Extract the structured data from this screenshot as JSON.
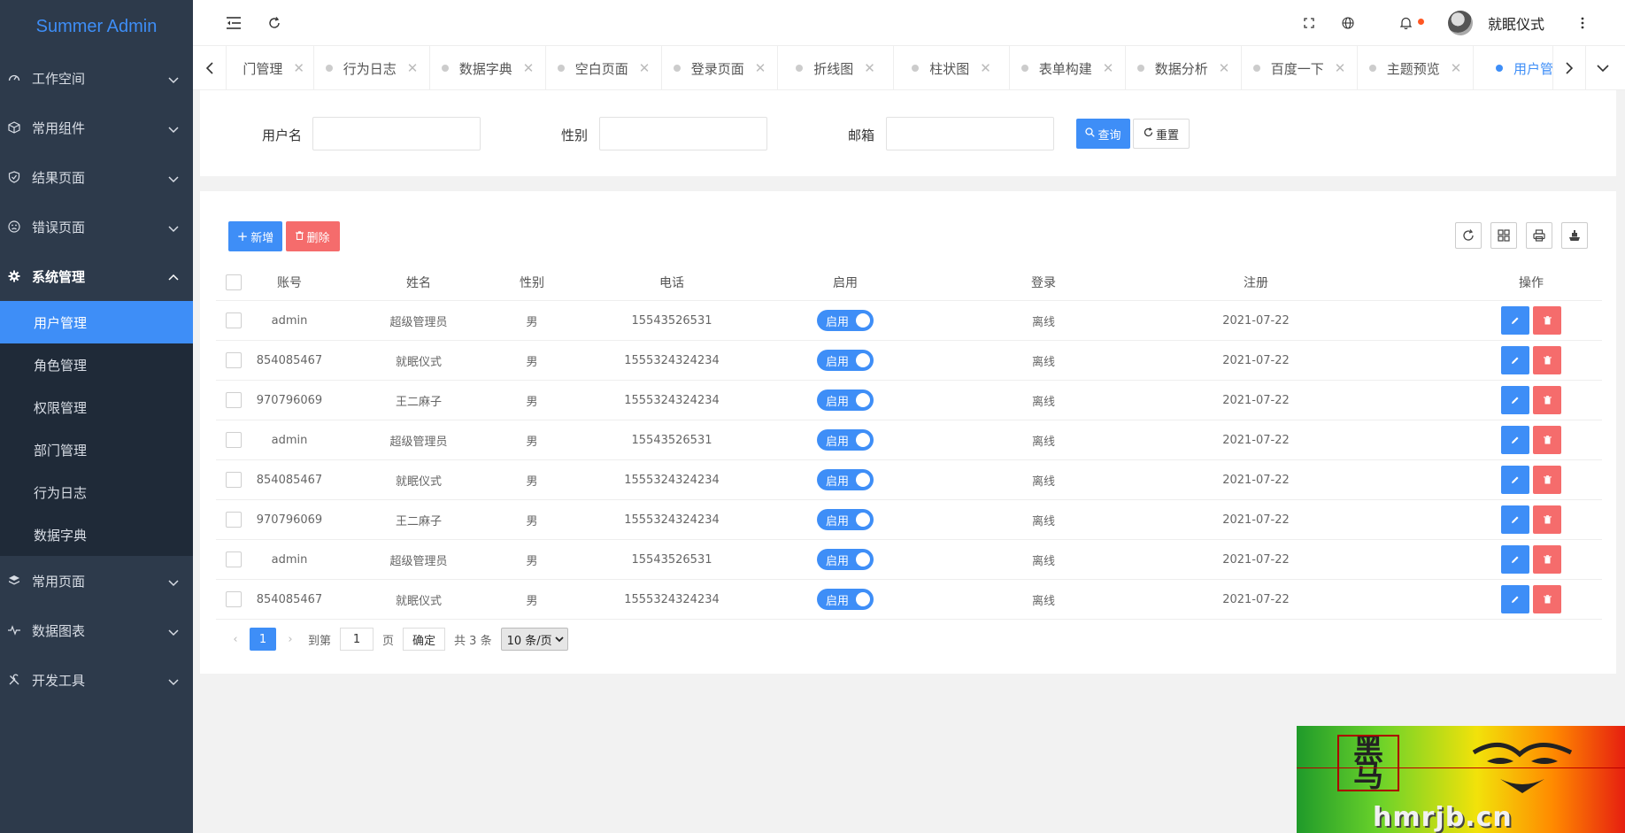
{
  "app": {
    "title": "Summer Admin"
  },
  "sidebar": {
    "menus": [
      {
        "label": "工作空间",
        "icon": "dashboard-icon"
      },
      {
        "label": "常用组件",
        "icon": "cube-icon"
      },
      {
        "label": "结果页面",
        "icon": "shield-check-icon"
      },
      {
        "label": "错误页面",
        "icon": "sad-face-icon"
      },
      {
        "label": "系统管理",
        "icon": "gear-icon"
      }
    ],
    "submenu": [
      "用户管理",
      "角色管理",
      "权限管理",
      "部门管理",
      "行为日志",
      "数据字典"
    ],
    "menus_after": [
      {
        "label": "常用页面",
        "icon": "layers-icon"
      },
      {
        "label": "数据图表",
        "icon": "pulse-icon"
      },
      {
        "label": "开发工具",
        "icon": "tools-icon"
      }
    ]
  },
  "header": {
    "user_name": "就眠仪式"
  },
  "tabs": [
    "门管理",
    "行为日志",
    "数据字典",
    "空白页面",
    "登录页面",
    "折线图",
    "柱状图",
    "表单构建",
    "数据分析",
    "百度一下",
    "主题预览",
    "用户管理"
  ],
  "search": {
    "username_label": "用户名",
    "gender_label": "性别",
    "email_label": "邮箱",
    "query_label": "查询",
    "reset_label": "重置"
  },
  "toolbar": {
    "add_label": "新增",
    "delete_label": "删除"
  },
  "table": {
    "headers": [
      "账号",
      "姓名",
      "性别",
      "电话",
      "启用",
      "登录",
      "注册",
      "操作"
    ],
    "rows": [
      {
        "account": "admin",
        "name": "超级管理员",
        "gender": "男",
        "phone": "15543526531",
        "enabled": "启用",
        "login": "离线",
        "registered": "2021-07-22"
      },
      {
        "account": "854085467",
        "name": "就眠仪式",
        "gender": "男",
        "phone": "1555324324234",
        "enabled": "启用",
        "login": "离线",
        "registered": "2021-07-22"
      },
      {
        "account": "970796069",
        "name": "王二麻子",
        "gender": "男",
        "phone": "1555324324234",
        "enabled": "启用",
        "login": "离线",
        "registered": "2021-07-22"
      },
      {
        "account": "admin",
        "name": "超级管理员",
        "gender": "男",
        "phone": "15543526531",
        "enabled": "启用",
        "login": "离线",
        "registered": "2021-07-22"
      },
      {
        "account": "854085467",
        "name": "就眠仪式",
        "gender": "男",
        "phone": "1555324324234",
        "enabled": "启用",
        "login": "离线",
        "registered": "2021-07-22"
      },
      {
        "account": "970796069",
        "name": "王二麻子",
        "gender": "男",
        "phone": "1555324324234",
        "enabled": "启用",
        "login": "离线",
        "registered": "2021-07-22"
      },
      {
        "account": "admin",
        "name": "超级管理员",
        "gender": "男",
        "phone": "15543526531",
        "enabled": "启用",
        "login": "离线",
        "registered": "2021-07-22"
      },
      {
        "account": "854085467",
        "name": "就眠仪式",
        "gender": "男",
        "phone": "1555324324234",
        "enabled": "启用",
        "login": "离线",
        "registered": "2021-07-22"
      }
    ]
  },
  "pagination": {
    "current": "1",
    "goto_label": "到第",
    "goto_value": "1",
    "page_unit": "页",
    "confirm_label": "确定",
    "total_text": "共 3 条",
    "page_size": "10 条/页"
  },
  "watermark": {
    "text": "hmrjb.cn",
    "logo_chars": "黑马"
  },
  "colors": {
    "accent": "#3e8ef7",
    "danger": "#f56c6c",
    "sidebar_bg": "#2d3a4b"
  }
}
